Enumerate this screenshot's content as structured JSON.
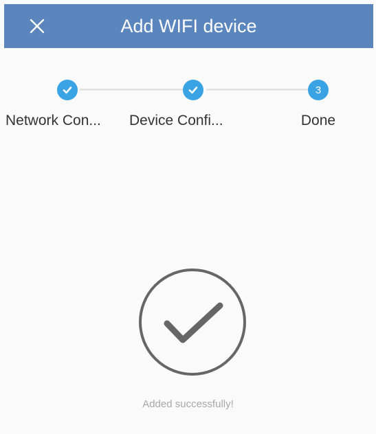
{
  "header": {
    "title": "Add WIFI device",
    "close_icon": "close-icon",
    "background": "#5b86bd"
  },
  "steps": [
    {
      "label": "Network Con...",
      "state": "completed",
      "icon": "check-icon"
    },
    {
      "label": "Device Confi...",
      "state": "completed",
      "icon": "check-icon"
    },
    {
      "label": "Done",
      "state": "current",
      "number": "3"
    }
  ],
  "colors": {
    "step_active": "#3aa3e3",
    "step_line": "#e4e4e4",
    "success_icon": "#666666",
    "status_text": "#a8a8a8"
  },
  "result": {
    "icon": "success-check-circle-icon",
    "message": "Added successfully!"
  }
}
